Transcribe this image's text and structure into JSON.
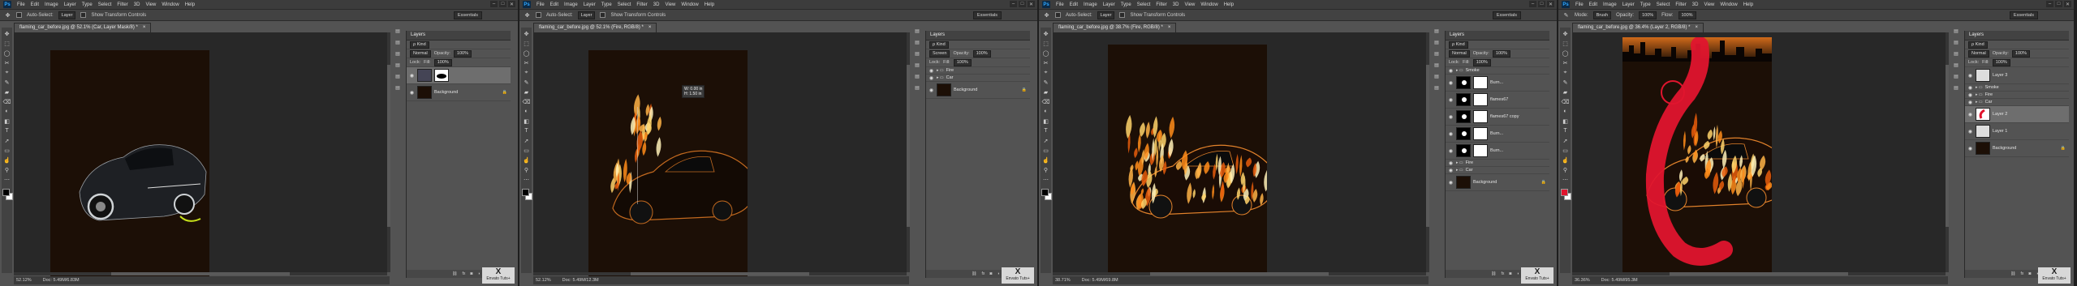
{
  "app": {
    "logo": "Ps",
    "menu": [
      "File",
      "Edit",
      "Image",
      "Layer",
      "Type",
      "Select",
      "Filter",
      "3D",
      "View",
      "Window",
      "Help"
    ],
    "window_controls": [
      "–",
      "□",
      "✕"
    ]
  },
  "options": {
    "auto_select": "Auto-Select:",
    "target": "Layer",
    "transform": "Show Transform Controls",
    "workspace": "Essentials"
  },
  "options_brush": {
    "mode_label": "Mode:",
    "mode": "Brush",
    "opacity_label": "Opacity:",
    "opacity": "100%",
    "flow_label": "Flow:",
    "flow": "100%",
    "workspace": "Essentials"
  },
  "layers_panel_title": "Layers",
  "layers_ctrls": {
    "kind": "ρ Kind",
    "blend_normal": "Normal",
    "blend_screen": "Screen",
    "opacity": "Opacity:",
    "opacity_val": "100%",
    "lock": "Lock:",
    "fill": "Fill:",
    "fill_val": "100%"
  },
  "icons": {
    "eye": "eye-icon",
    "lock": "lock-icon",
    "folder": "folder-icon",
    "move": "move-tool-icon",
    "brush": "brush-tool-icon"
  },
  "windows": [
    {
      "tab": "flaming_car_before.jpg @ 52.1% (Car, Layer Mask/8) *",
      "status_zoom": "52.12%",
      "status_doc": "Doc: 5.49M/6.83M",
      "layers": [
        {
          "name": "",
          "type": "layer-mask",
          "selected": true
        },
        {
          "name": "Background",
          "type": "background",
          "locked": true
        }
      ]
    },
    {
      "tab": "flaming_car_before.jpg @ 52.1% (Fire, RGB/8) *",
      "status_zoom": "52.12%",
      "status_doc": "Doc: 5.49M/12.3M",
      "hud": [
        "W: 0.00 in",
        "H: 1.50 in"
      ],
      "layers": [
        {
          "name": "Fire",
          "type": "group"
        },
        {
          "name": "Car",
          "type": "group"
        },
        {
          "name": "Background",
          "type": "background",
          "locked": true
        }
      ]
    },
    {
      "tab": "flaming_car_before.jpg @ 38.7% (Fire, RGB/8) *",
      "status_zoom": "38.71%",
      "status_doc": "Doc: 5.49M/69.8M",
      "layers": [
        {
          "name": "Smoke",
          "type": "group"
        },
        {
          "name": "Burn...",
          "type": "masked"
        },
        {
          "name": "flames67",
          "type": "masked"
        },
        {
          "name": "flames67 copy",
          "type": "masked"
        },
        {
          "name": "Burn...",
          "type": "masked"
        },
        {
          "name": "Burn...",
          "type": "masked"
        },
        {
          "name": "Fire",
          "type": "group"
        },
        {
          "name": "Car",
          "type": "group"
        },
        {
          "name": "Background",
          "type": "background",
          "locked": true
        }
      ]
    },
    {
      "tab": "flaming_car_before.jpg @ 36.4% (Layer 2, RGB/8) *",
      "status_zoom": "36.36%",
      "status_doc": "Doc: 5.49M/95.3M",
      "layers": [
        {
          "name": "Layer 3",
          "type": "layer"
        },
        {
          "name": "Smoke",
          "type": "group"
        },
        {
          "name": "Fire",
          "type": "group"
        },
        {
          "name": "Car",
          "type": "group"
        },
        {
          "name": "Layer 2",
          "type": "layer",
          "selected": true
        },
        {
          "name": "Layer 1",
          "type": "layer"
        },
        {
          "name": "Background",
          "type": "background",
          "locked": true
        }
      ]
    }
  ],
  "watermark": {
    "logo": "X",
    "site": "Envato Tuts+"
  }
}
